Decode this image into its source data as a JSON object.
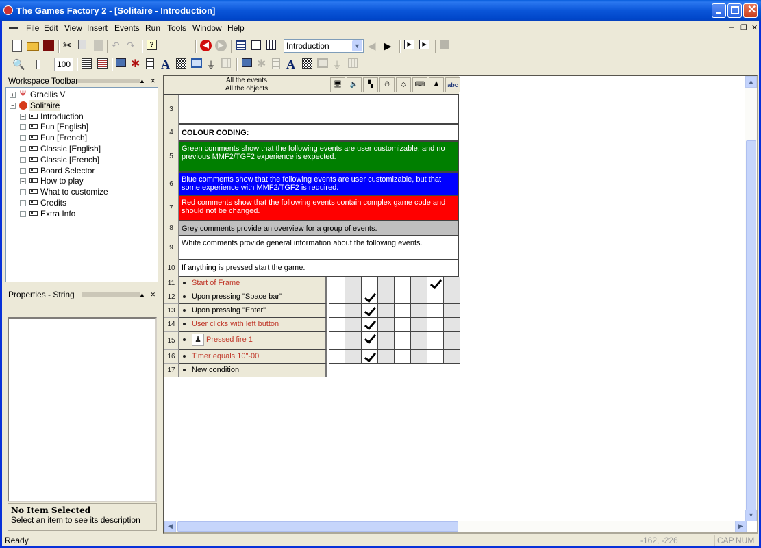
{
  "window": {
    "title": "The Games Factory 2 - [Solitaire - Introduction]"
  },
  "menu": {
    "items": [
      "File",
      "Edit",
      "View",
      "Insert",
      "Events",
      "Run",
      "Tools",
      "Window",
      "Help"
    ]
  },
  "toolbar1": {
    "icons": [
      "new-icon",
      "open-icon",
      "save-icon",
      "cut-icon",
      "copy-icon",
      "paste-icon",
      "undo-icon",
      "redo-icon",
      "help-icon",
      "back-icon",
      "forward-icon",
      "storyboard-editor-icon",
      "frame-editor-icon",
      "event-editor-icon"
    ],
    "frame_select": {
      "value": "Introduction"
    },
    "after_icons": [
      "previous-frame-icon",
      "next-frame-icon",
      "run-frame-icon",
      "run-application-icon",
      "stop-icon"
    ]
  },
  "toolbar2": {
    "zoom_value": "100",
    "icons": [
      "zoom-icon",
      "zoom-slider",
      "insert-event-icon",
      "insert-comment-icon",
      "system-object-icon",
      "actives-icon",
      "backdrops-icon",
      "text-icon",
      "quick-backdrop-icon",
      "counters-icon",
      "extensions-icon",
      "grid-icon"
    ]
  },
  "workspace": {
    "title": "Workspace Toolbar",
    "tree": [
      {
        "label": "Gracilis V",
        "level": 0,
        "expanded": false
      },
      {
        "label": "Solitaire",
        "level": 0,
        "expanded": true,
        "selected": true
      },
      {
        "label": "Introduction",
        "level": 1
      },
      {
        "label": "Fun [English]",
        "level": 1
      },
      {
        "label": "Fun [French]",
        "level": 1
      },
      {
        "label": "Classic [English]",
        "level": 1
      },
      {
        "label": "Classic [French]",
        "level": 1
      },
      {
        "label": "Board Selector",
        "level": 1
      },
      {
        "label": "How to play",
        "level": 1
      },
      {
        "label": "What to customize",
        "level": 1
      },
      {
        "label": "Credits",
        "level": 1
      },
      {
        "label": "Extra Info",
        "level": 1
      }
    ]
  },
  "properties": {
    "title": "Properties - String",
    "desc_title": "No Item Selected",
    "desc_text": "Select an item to see its description"
  },
  "event_editor": {
    "header": {
      "line1": "All the events",
      "line2": "All the objects"
    },
    "object_icons": [
      "special-conditions-icon",
      "sound-icon",
      "storyboard-controls-icon",
      "timer-icon",
      "create-objects-icon",
      "keyboard-mouse-icon",
      "player-icon",
      "string-object-icon"
    ],
    "comments": [
      {
        "num": "3",
        "text": "",
        "bg": "#ffffff",
        "color": "#000000"
      },
      {
        "num": "4",
        "text": "COLOUR CODING:",
        "bg": "#ffffff",
        "color": "#000000",
        "bold": true
      },
      {
        "num": "5",
        "text": "Green comments show that the following events are user customizable, and no previous MMF2/TGF2 experience is expected.",
        "bg": "#007f00",
        "color": "#ffffff"
      },
      {
        "num": "6",
        "text": "Blue comments show that the following events are user customizable, but that some experience with MMF2/TGF2 is required.",
        "bg": "#0000ff",
        "color": "#ffffff"
      },
      {
        "num": "7",
        "text": "Red comments show that the following events contain complex game code and should not be changed.",
        "bg": "#ff0000",
        "color": "#ffffff"
      },
      {
        "num": "8",
        "text": "Grey comments provide an overview for a group of events.",
        "bg": "#c0c0c0",
        "color": "#000000"
      },
      {
        "num": "9",
        "text": "White comments provide general information about the following events.",
        "bg": "#ffffff",
        "color": "#000000"
      },
      {
        "num": "10",
        "text": "If anything is pressed start the game.",
        "bg": "#ffffff",
        "color": "#000000"
      }
    ],
    "events": [
      {
        "num": "11",
        "condition": "Start of Frame",
        "color": "#c0392b",
        "checks": [
          6
        ]
      },
      {
        "num": "12",
        "condition": "Upon pressing \"Space bar\"",
        "color": "#000000",
        "checks": [
          2
        ]
      },
      {
        "num": "13",
        "condition": "Upon pressing \"Enter\"",
        "color": "#000000",
        "checks": [
          2
        ]
      },
      {
        "num": "14",
        "condition": "User clicks with left button",
        "color": "#c0392b",
        "checks": [
          2
        ]
      },
      {
        "num": "15",
        "condition": "Pressed fire 1",
        "color": "#c0392b",
        "checks": [
          2
        ],
        "has_icon": true
      },
      {
        "num": "16",
        "condition": "Timer equals 10\"-00",
        "color": "#c0392b",
        "checks": [
          2
        ]
      },
      {
        "num": "17",
        "condition": "New condition",
        "color": "#000000",
        "new": true
      }
    ]
  },
  "status": {
    "text": "Ready",
    "coords": "-162, -226",
    "cap": "CAP",
    "num": "NUM"
  }
}
